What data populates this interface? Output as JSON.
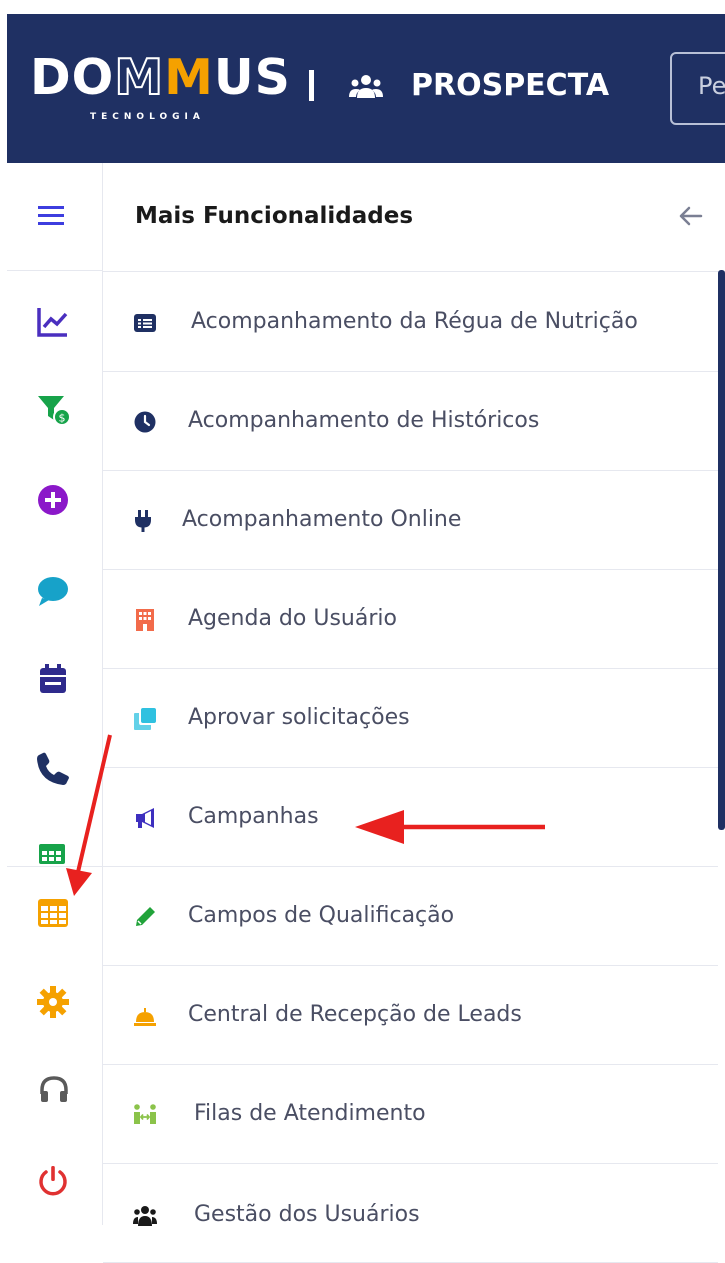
{
  "header": {
    "logo": {
      "part1": "DO",
      "part2": "MM",
      "part3": "US",
      "subtitle": "TECNOLOGIA"
    },
    "module": {
      "icon": "users-icon",
      "name": "PROSPECTA"
    },
    "search": {
      "placeholder": "Pe"
    }
  },
  "rail": {
    "items": [
      {
        "icon": "menu-toggle-icon",
        "color": "#3d3ddf"
      },
      {
        "icon": "chart-line-icon",
        "color": "#4a2fbf"
      },
      {
        "icon": "funnel-dollar-icon",
        "color": "#17a34a"
      },
      {
        "icon": "plus-circle-icon",
        "color": "#8b18c9"
      },
      {
        "icon": "chat-bubble-icon",
        "color": "#17a2c9"
      },
      {
        "icon": "calendar-icon",
        "color": "#2e2a8c"
      },
      {
        "icon": "phone-icon",
        "color": "#1f3063"
      },
      {
        "icon": "table-green-icon",
        "color": "#17a34a"
      },
      {
        "icon": "table-orange-icon",
        "color": "#f5a100"
      },
      {
        "icon": "gear-icon",
        "color": "#f5a100"
      },
      {
        "icon": "headset-icon",
        "color": "#5a5a5a"
      },
      {
        "icon": "power-icon",
        "color": "#e03131"
      }
    ]
  },
  "panel": {
    "title": "Mais Funcionalidades",
    "back_icon": "arrow-left-icon",
    "items": [
      {
        "label": "Acompanhamento da Régua de Nutrição",
        "icon": "list-alt-icon",
        "color": "#1f3063"
      },
      {
        "label": "Acompanhamento de Históricos",
        "icon": "clock-icon",
        "color": "#1f3063"
      },
      {
        "label": "Acompanhamento Online",
        "icon": "plug-icon",
        "color": "#1f3063"
      },
      {
        "label": "Agenda do Usuário",
        "icon": "building-icon",
        "color": "#f26b4a"
      },
      {
        "label": "Aprovar solicitações",
        "icon": "clone-icon",
        "color": "#2fc1e0"
      },
      {
        "label": "Campanhas",
        "icon": "megaphone-icon",
        "color": "#3d2fbf"
      },
      {
        "label": "Campos de Qualificação",
        "icon": "pencil-icon",
        "color": "#21a33a"
      },
      {
        "label": "Central de Recepção de Leads",
        "icon": "bell-concierge-icon",
        "color": "#f5a100"
      },
      {
        "label": "Filas de Atendimento",
        "icon": "people-arrows-icon",
        "color": "#8bc34a"
      },
      {
        "label": "Gestão dos Usuários",
        "icon": "users-icon",
        "color": "#1a1a1a"
      }
    ]
  },
  "annotations": {
    "color": "#e8211f"
  }
}
